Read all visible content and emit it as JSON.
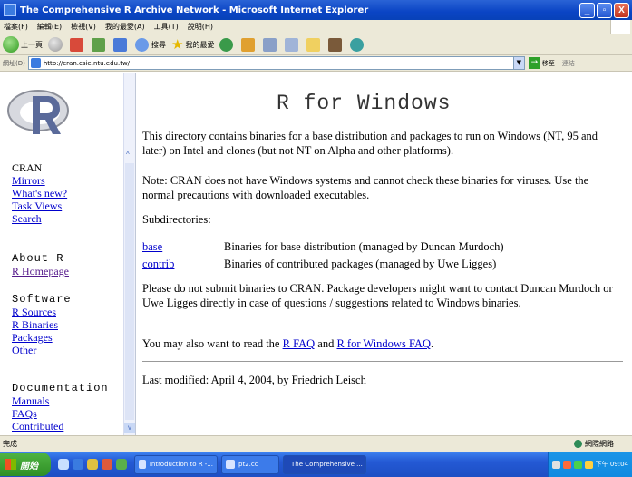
{
  "window": {
    "title": "The Comprehensive R Archive Network - Microsoft Internet Explorer",
    "buttons": [
      "_",
      "▫",
      "X"
    ]
  },
  "menu": [
    "檔案(F)",
    "編輯(E)",
    "檢視(V)",
    "我的最愛(A)",
    "工具(T)",
    "說明(H)"
  ],
  "toolbar": {
    "back_label": "上一頁",
    "search_label": "搜尋",
    "favorites_label": "我的最愛"
  },
  "address": {
    "label": "網址(D)",
    "url": "http://cran.csie.ntu.edu.tw/",
    "go_label": "移至",
    "links_label": "連結"
  },
  "sidebar": {
    "sections": [
      {
        "heading": "CRAN",
        "links": [
          "Mirrors",
          "What's new?",
          "Task Views",
          "Search"
        ]
      },
      {
        "heading": "About R",
        "links": [
          "R Homepage"
        ]
      },
      {
        "heading": "Software",
        "links": [
          "R Sources",
          "R Binaries",
          "Packages",
          "Other"
        ]
      },
      {
        "heading": "Documentation",
        "links": [
          "Manuals",
          "FAQs",
          "Contributed"
        ]
      }
    ]
  },
  "main": {
    "title": "R for Windows",
    "intro": "This directory contains binaries for a base distribution and packages to run on Windows (NT, 95 and later) on Intel and clones (but not NT on Alpha and other platforms).",
    "note": "Note: CRAN does not have Windows systems and cannot check these binaries for viruses. Use the normal precautions with downloaded executables.",
    "subdir_heading": "Subdirectories:",
    "subdirs": [
      {
        "name": "base",
        "desc": "Binaries for base distribution (managed by Duncan Murdoch)"
      },
      {
        "name": "contrib",
        "desc": "Binaries of contributed packages (managed by Uwe Ligges)"
      }
    ],
    "contact": "Please do not submit binaries to CRAN. Package developers might want to contact Duncan Murdoch or Uwe Ligges directly in case of questions / suggestions related to Windows binaries.",
    "faq_prefix": "You may also want to read the ",
    "faq_link1": "R FAQ",
    "faq_mid": " and ",
    "faq_link2": "R for Windows FAQ",
    "faq_suffix": ".",
    "last_modified": "Last modified: April 4, 2004, by Friedrich Leisch"
  },
  "status": {
    "text": "完成",
    "zone": "網際網路"
  },
  "taskbar": {
    "start": "開始",
    "tasks": [
      "Introduction to R -...",
      "pt2.cc",
      "The Comprehensive ..."
    ],
    "clock": "下午 09:04"
  }
}
